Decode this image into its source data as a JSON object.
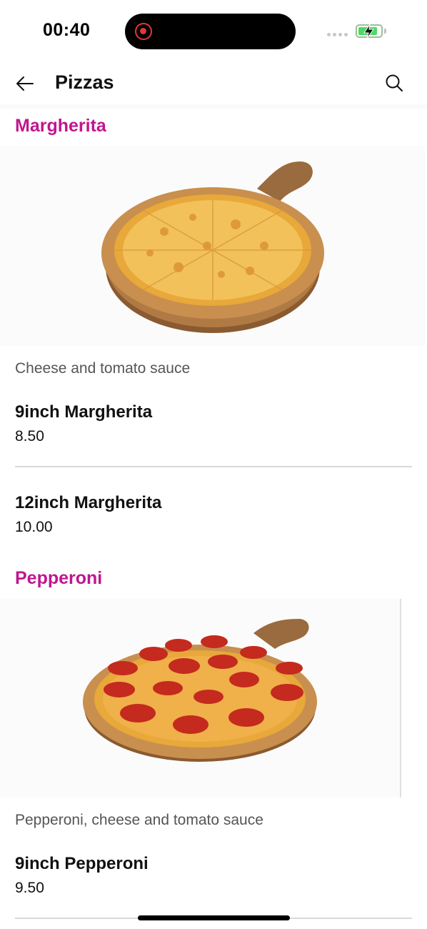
{
  "status_bar": {
    "time": "00:40",
    "icons": [
      "screen-record-icon",
      "signal-dots-icon",
      "battery-charging-icon"
    ],
    "battery_level": 0.85,
    "colors": {
      "record": "#e03a2f",
      "battery": "#4cd964"
    }
  },
  "header": {
    "title": "Pizzas",
    "back_icon": "arrow-left-icon",
    "search_icon": "search-icon"
  },
  "theme": {
    "accent": "#c0168e"
  },
  "sections": [
    {
      "title": "Margherita",
      "image": "margherita-pizza-image",
      "description": "Cheese and tomato sauce",
      "items": [
        {
          "name": "9inch Margherita",
          "price": "8.50"
        },
        {
          "name": "12inch Margherita",
          "price": "10.00"
        }
      ]
    },
    {
      "title": "Pepperoni",
      "image": "pepperoni-pizza-image",
      "description": "Pepperoni, cheese and tomato sauce",
      "items": [
        {
          "name": "9inch Pepperoni",
          "price": "9.50"
        }
      ]
    }
  ]
}
